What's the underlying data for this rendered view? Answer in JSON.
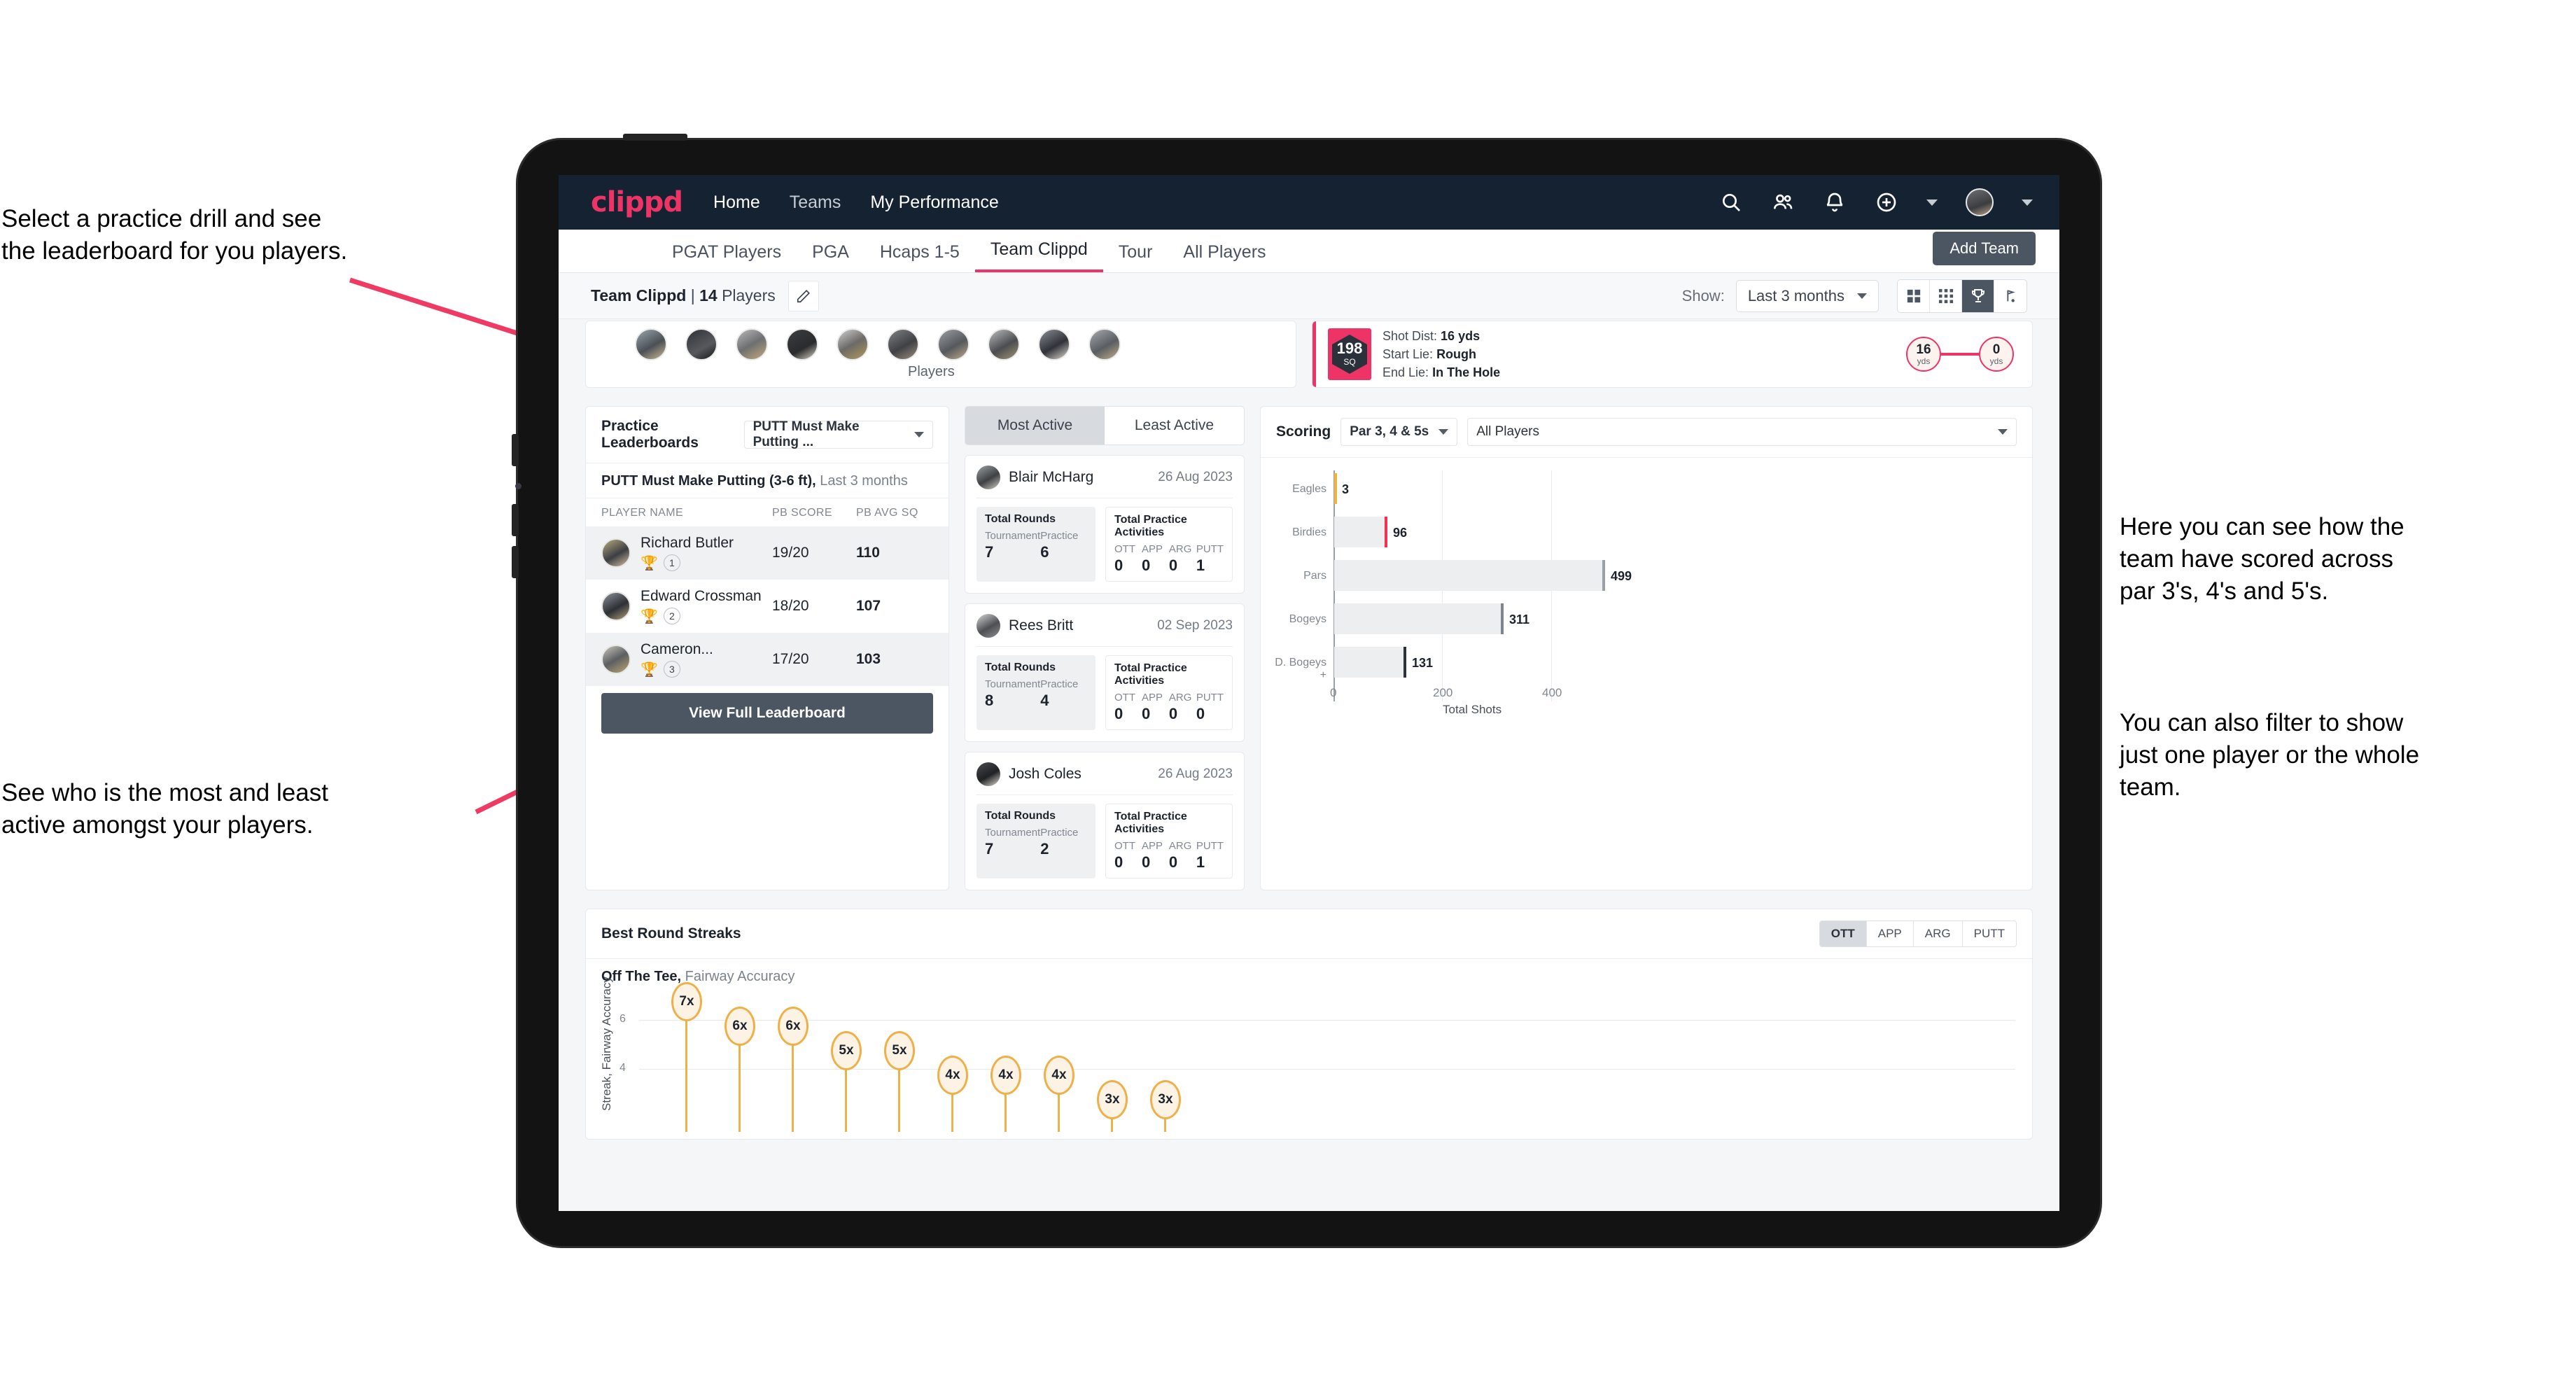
{
  "annotations": {
    "top_left": "Select a practice drill and see\nthe leaderboard for you players.",
    "bottom_left": "See who is the most and least\nactive amongst your players.",
    "right_1": "Here you can see how the\nteam have scored across\npar 3's, 4's and 5's.",
    "right_2": "You can also filter to show\njust one player or the whole\nteam.",
    "arrow_color": "#ef3b63"
  },
  "navbar": {
    "brand": "clippd",
    "links": [
      {
        "label": "Home",
        "active": true
      },
      {
        "label": "Teams",
        "active": false
      },
      {
        "label": "My Performance",
        "active": true
      }
    ],
    "icons": [
      "search-icon",
      "people-icon",
      "bell-icon",
      "plus-circle-icon",
      "avatar"
    ]
  },
  "tabs": [
    {
      "label": "PGAT Players",
      "active": false
    },
    {
      "label": "PGA",
      "active": false
    },
    {
      "label": "Hcaps 1-5",
      "active": false
    },
    {
      "label": "Team Clippd",
      "active": true
    },
    {
      "label": "Tour",
      "active": false
    },
    {
      "label": "All Players",
      "active": false
    }
  ],
  "add_team_button": "Add Team",
  "subheader": {
    "team_name": "Team Clippd",
    "separator": "|",
    "player_count": "14",
    "players_word": "Players",
    "edit_icon": "pencil-icon",
    "show_label": "Show:",
    "show_value": "Last 3 months",
    "view_buttons": [
      "grid-large-icon",
      "grid-small-icon",
      "trophy-icon",
      "flag-icon"
    ],
    "active_view": "trophy-icon"
  },
  "players_strip": {
    "caption": "Players",
    "avatar_count": 10
  },
  "shot_card": {
    "badge_number": "198",
    "badge_label": "SQ",
    "lines": [
      {
        "key": "Shot Dist:",
        "value": "16 yds"
      },
      {
        "key": "Start Lie:",
        "value": "Rough"
      },
      {
        "key": "End Lie:",
        "value": "In The Hole"
      }
    ],
    "start_value": "16",
    "start_unit": "yds",
    "end_value": "0",
    "end_unit": "yds"
  },
  "practice_leaderboard": {
    "title": "Practice Leaderboards",
    "drill_select": "PUTT Must Make Putting ...",
    "subtitle_bold": "PUTT Must Make Putting (3-6 ft),",
    "subtitle_light": "Last 3 months",
    "columns": [
      "PLAYER NAME",
      "PB SCORE",
      "PB AVG SQ"
    ],
    "rows": [
      {
        "name": "Richard Butler",
        "rank": "1",
        "trophy": "gold",
        "pb_score": "19/20",
        "pb_avg_sq": "110"
      },
      {
        "name": "Edward Crossman",
        "rank": "2",
        "trophy": "silver",
        "pb_score": "18/20",
        "pb_avg_sq": "107"
      },
      {
        "name": "Cameron...",
        "rank": "3",
        "trophy": "bronze",
        "pb_score": "17/20",
        "pb_avg_sq": "103"
      }
    ],
    "button": "View Full Leaderboard"
  },
  "activity": {
    "tabs": [
      {
        "label": "Most Active",
        "active": true
      },
      {
        "label": "Least Active",
        "active": false
      }
    ],
    "rounds_title": "Total Rounds",
    "practice_title": "Total Practice Activities",
    "rounds_cols": [
      "Tournament",
      "Practice"
    ],
    "practice_cols": [
      "OTT",
      "APP",
      "ARG",
      "PUTT"
    ],
    "items": [
      {
        "name": "Blair McHarg",
        "date": "26 Aug 2023",
        "tournament": "7",
        "practice": "6",
        "ott": "0",
        "app": "0",
        "arg": "0",
        "putt": "1"
      },
      {
        "name": "Rees Britt",
        "date": "02 Sep 2023",
        "tournament": "8",
        "practice": "4",
        "ott": "0",
        "app": "0",
        "arg": "0",
        "putt": "0"
      },
      {
        "name": "Josh Coles",
        "date": "26 Aug 2023",
        "tournament": "7",
        "practice": "2",
        "ott": "0",
        "app": "0",
        "arg": "0",
        "putt": "1"
      }
    ]
  },
  "scoring": {
    "title": "Scoring",
    "par_select": "Par 3, 4 & 5s",
    "player_select": "All Players"
  },
  "streaks": {
    "title": "Best Round Streaks",
    "segments": [
      {
        "label": "OTT",
        "active": true
      },
      {
        "label": "APP",
        "active": false
      },
      {
        "label": "ARG",
        "active": false
      },
      {
        "label": "PUTT",
        "active": false
      }
    ],
    "sub_bold": "Off The Tee,",
    "sub_light": "Fairway Accuracy"
  },
  "chart_data": [
    {
      "type": "bar",
      "orientation": "horizontal",
      "title": "Scoring",
      "categories": [
        "Eagles",
        "Birdies",
        "Pars",
        "Bogeys",
        "D. Bogeys +"
      ],
      "values": [
        3,
        96,
        499,
        311,
        131
      ],
      "bar_cap_colors": [
        "#f0b63c",
        "#ee3355",
        "#9aa0a8",
        "#7d848d",
        "#2b323b"
      ],
      "xlabel": "Total Shots",
      "ylabel": "",
      "xlim": [
        0,
        540
      ],
      "xticks": [
        0,
        200,
        400
      ],
      "grid": true,
      "legend": "none"
    },
    {
      "type": "scatter",
      "title": "Best Round Streaks",
      "subtitle": "Off The Tee, Fairway Accuracy",
      "ylabel": "Streak, Fairway Accuracy",
      "values": [
        7,
        6,
        6,
        5,
        5,
        4,
        4,
        4,
        3,
        3
      ],
      "labels": [
        "7x",
        "6x",
        "6x",
        "5x",
        "5x",
        "4x",
        "4x",
        "4x",
        "3x",
        "3x"
      ],
      "yticks": [
        4,
        6
      ],
      "ylim": [
        0,
        8
      ],
      "marker": "pin",
      "marker_color": "#eeb14a",
      "grid": true
    }
  ]
}
